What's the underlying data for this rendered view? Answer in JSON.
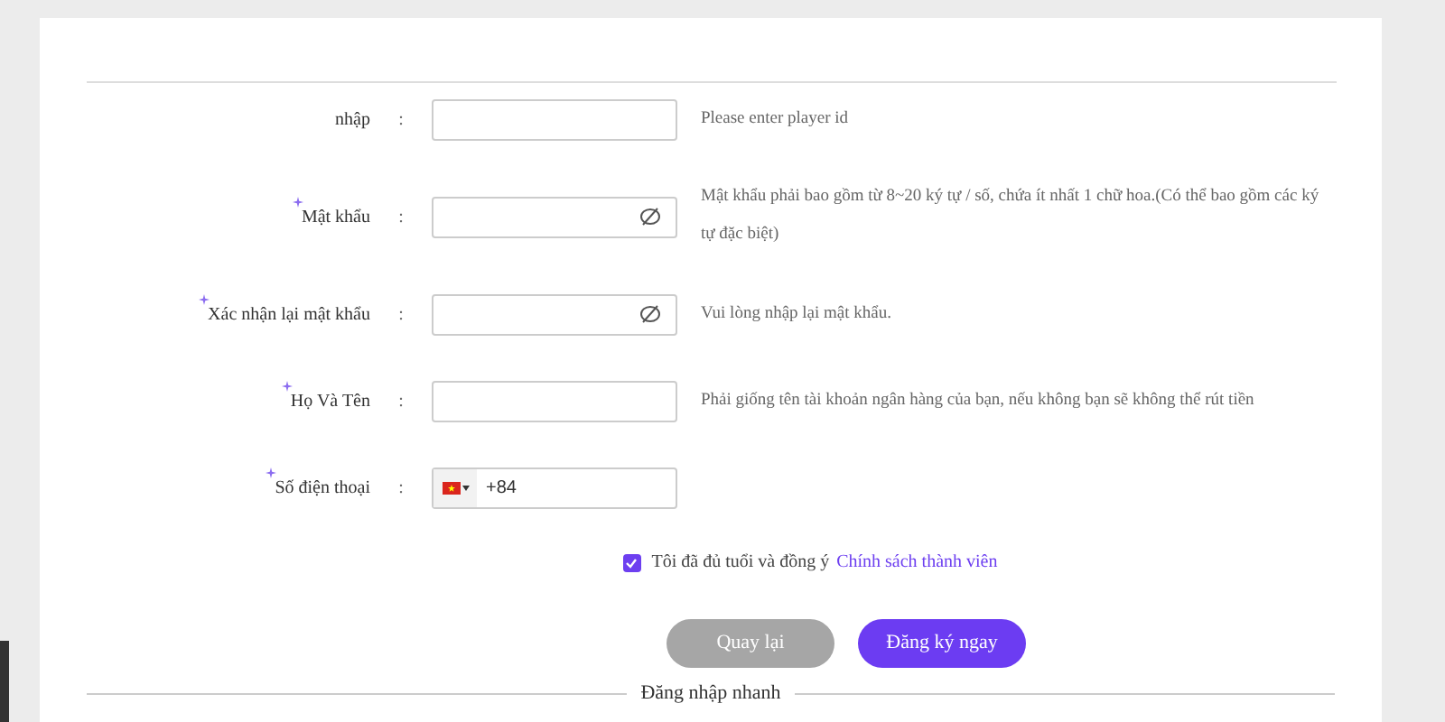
{
  "fields": [
    {
      "label": "nhập",
      "separator": ":",
      "required": false,
      "kind": "text",
      "hint": "Please enter player id"
    },
    {
      "label": "Mật khẩu",
      "separator": ":",
      "required": true,
      "kind": "password",
      "hint": "Mật khẩu phải bao gồm từ 8~20 ký tự / số, chứa ít nhất 1 chữ hoa.(Có thể bao gồm các ký tự đặc biệt)"
    },
    {
      "label": "Xác nhận lại mật khẩu",
      "separator": ":",
      "required": true,
      "kind": "password",
      "hint": "Vui lòng nhập lại mật khẩu."
    },
    {
      "label": "Họ Và Tên",
      "separator": ":",
      "required": true,
      "kind": "text",
      "hint": "Phải giống tên tài khoản ngân hàng của bạn, nếu không bạn sẽ không thể rút tiền"
    },
    {
      "label": "Số điện thoại",
      "separator": ":",
      "required": true,
      "kind": "phone",
      "value": "+84"
    }
  ],
  "agreement": {
    "checked": true,
    "text": "Tôi đã đủ tuổi và đồng ý",
    "link": "Chính sách thành viên"
  },
  "buttons": [
    {
      "label": "Quay lại",
      "kind": "secondary"
    },
    {
      "label": "Đăng ký ngay",
      "kind": "primary"
    }
  ],
  "quick_login": {
    "title": "Đăng nhập nhanh"
  }
}
